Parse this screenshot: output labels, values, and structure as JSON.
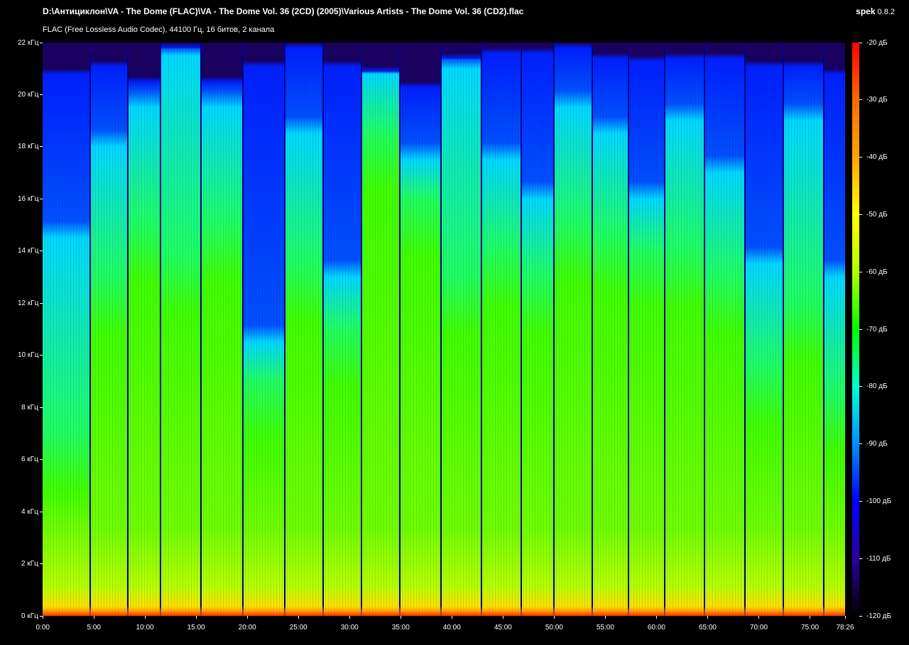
{
  "header": {
    "file_path": "D:\\Антициклон\\VA - The Dome (FLAC)\\VA - The Dome Vol. 36 (2CD) (2005)\\Various Artists - The Dome Vol. 36 (CD2).flac",
    "format_info": "FLAC (Free Lossless Audio Codec), 44100 Гц, 16 битов, 2 канала",
    "app_name": "spek",
    "app_version": "0.8.2"
  },
  "chart_data": {
    "type": "heatmap",
    "title": "",
    "xlabel": "",
    "ylabel": "",
    "x_unit": "mm:ss",
    "x_range": [
      "0:00",
      "78:26"
    ],
    "x_total_seconds": 4706,
    "x_ticks": [
      {
        "label": "0:00",
        "seconds": 0
      },
      {
        "label": "5:00",
        "seconds": 300
      },
      {
        "label": "10:00",
        "seconds": 600
      },
      {
        "label": "15:00",
        "seconds": 900
      },
      {
        "label": "20:00",
        "seconds": 1200
      },
      {
        "label": "25:00",
        "seconds": 1500
      },
      {
        "label": "30:00",
        "seconds": 1800
      },
      {
        "label": "35:00",
        "seconds": 2100
      },
      {
        "label": "40:00",
        "seconds": 2400
      },
      {
        "label": "45:00",
        "seconds": 2700
      },
      {
        "label": "50:00",
        "seconds": 3000
      },
      {
        "label": "55:00",
        "seconds": 3300
      },
      {
        "label": "60:00",
        "seconds": 3600
      },
      {
        "label": "65:00",
        "seconds": 3900
      },
      {
        "label": "70:00",
        "seconds": 4200
      },
      {
        "label": "75:00",
        "seconds": 4500
      },
      {
        "label": "78:26",
        "seconds": 4706
      }
    ],
    "y_unit": "kHz",
    "y_range": [
      0,
      22
    ],
    "y_ticks": [
      {
        "label": "0 кГц",
        "khz": 0
      },
      {
        "label": "2 кГц",
        "khz": 2
      },
      {
        "label": "4 кГц",
        "khz": 4
      },
      {
        "label": "6 кГц",
        "khz": 6
      },
      {
        "label": "8 кГц",
        "khz": 8
      },
      {
        "label": "10 кГц",
        "khz": 10
      },
      {
        "label": "12 кГц",
        "khz": 12
      },
      {
        "label": "14 кГц",
        "khz": 14
      },
      {
        "label": "16 кГц",
        "khz": 16
      },
      {
        "label": "18 кГц",
        "khz": 18
      },
      {
        "label": "20 кГц",
        "khz": 20
      },
      {
        "label": "22 кГц",
        "khz": 22
      }
    ],
    "colorbar": {
      "unit": "dB",
      "range": [
        -120,
        -20
      ],
      "ticks": [
        {
          "label": "-20 дБ",
          "db": -20
        },
        {
          "label": "-30 дБ",
          "db": -30
        },
        {
          "label": "-40 дБ",
          "db": -40
        },
        {
          "label": "-50 дБ",
          "db": -50
        },
        {
          "label": "-60 дБ",
          "db": -60
        },
        {
          "label": "-70 дБ",
          "db": -70
        },
        {
          "label": "-80 дБ",
          "db": -80
        },
        {
          "label": "-90 дБ",
          "db": -90
        },
        {
          "label": "-100 дБ",
          "db": -100
        },
        {
          "label": "-110 дБ",
          "db": -110
        },
        {
          "label": "-120 дБ",
          "db": -120
        }
      ]
    },
    "tracks": [
      {
        "start": 0,
        "end": 278,
        "green_top_khz": 7,
        "cyan_top_khz": 14.5,
        "blue_top_khz": 21
      },
      {
        "start": 278,
        "end": 498,
        "green_top_khz": 13,
        "cyan_top_khz": 18,
        "blue_top_khz": 21.3
      },
      {
        "start": 498,
        "end": 690,
        "green_top_khz": 15,
        "cyan_top_khz": 19.5,
        "blue_top_khz": 20.7
      },
      {
        "start": 690,
        "end": 928,
        "green_top_khz": 13.8,
        "cyan_top_khz": 21.5,
        "blue_top_khz": 22
      },
      {
        "start": 928,
        "end": 1175,
        "green_top_khz": 15,
        "cyan_top_khz": 19.5,
        "blue_top_khz": 20.7
      },
      {
        "start": 1175,
        "end": 1420,
        "green_top_khz": 9,
        "cyan_top_khz": 10.5,
        "blue_top_khz": 21.3
      },
      {
        "start": 1420,
        "end": 1645,
        "green_top_khz": 13.5,
        "cyan_top_khz": 18.5,
        "blue_top_khz": 22
      },
      {
        "start": 1645,
        "end": 1870,
        "green_top_khz": 11,
        "cyan_top_khz": 13,
        "blue_top_khz": 21.3
      },
      {
        "start": 1870,
        "end": 2095,
        "green_top_khz": 18.5,
        "cyan_top_khz": 20.8,
        "blue_top_khz": 21.1
      },
      {
        "start": 2095,
        "end": 2335,
        "green_top_khz": 16,
        "cyan_top_khz": 17.5,
        "blue_top_khz": 20.5
      },
      {
        "start": 2335,
        "end": 2575,
        "green_top_khz": 13,
        "cyan_top_khz": 21,
        "blue_top_khz": 21.6
      },
      {
        "start": 2575,
        "end": 2805,
        "green_top_khz": 14,
        "cyan_top_khz": 17.5,
        "blue_top_khz": 21.8
      },
      {
        "start": 2805,
        "end": 3000,
        "green_top_khz": 13,
        "cyan_top_khz": 16,
        "blue_top_khz": 21.8
      },
      {
        "start": 3000,
        "end": 3225,
        "green_top_khz": 15,
        "cyan_top_khz": 19.5,
        "blue_top_khz": 22
      },
      {
        "start": 3225,
        "end": 3435,
        "green_top_khz": 14.6,
        "cyan_top_khz": 18.5,
        "blue_top_khz": 21.6
      },
      {
        "start": 3435,
        "end": 3650,
        "green_top_khz": 14,
        "cyan_top_khz": 16,
        "blue_top_khz": 21.5
      },
      {
        "start": 3650,
        "end": 3880,
        "green_top_khz": 14,
        "cyan_top_khz": 19,
        "blue_top_khz": 21.6
      },
      {
        "start": 3880,
        "end": 4120,
        "green_top_khz": 13,
        "cyan_top_khz": 17,
        "blue_top_khz": 21.6
      },
      {
        "start": 4120,
        "end": 4345,
        "green_top_khz": 9.5,
        "cyan_top_khz": 13.5,
        "blue_top_khz": 21.3
      },
      {
        "start": 4345,
        "end": 4580,
        "green_top_khz": 12,
        "cyan_top_khz": 19,
        "blue_top_khz": 21.3
      },
      {
        "start": 4580,
        "end": 4706,
        "green_top_khz": 8.5,
        "cyan_top_khz": 13,
        "blue_top_khz": 21
      }
    ]
  }
}
